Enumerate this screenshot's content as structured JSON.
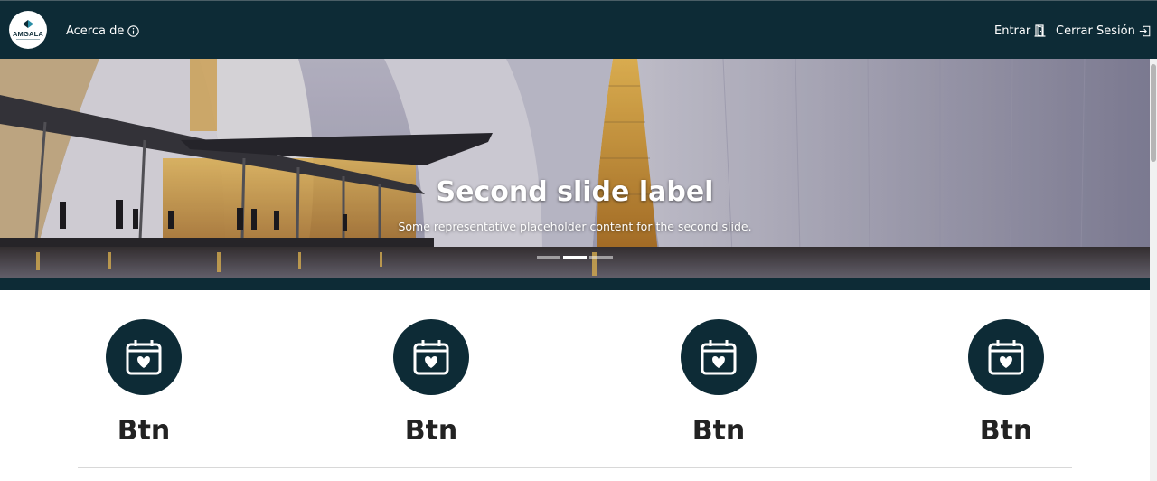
{
  "navbar": {
    "brand": "AMGALA",
    "about_label": "Acerca de",
    "login_label": "Entrar",
    "logout_label": "Cerrar Sesión"
  },
  "carousel": {
    "title": "Second slide label",
    "text": "Some representative placeholder content for the second slide.",
    "slide_count": 3,
    "active_slide": 2
  },
  "buttons": [
    {
      "label": "Btn",
      "icon": "calendar-heart-icon"
    },
    {
      "label": "Btn",
      "icon": "calendar-heart-icon"
    },
    {
      "label": "Btn",
      "icon": "calendar-heart-icon"
    },
    {
      "label": "Btn",
      "icon": "calendar-heart-icon"
    }
  ],
  "colors": {
    "primary": "#0d2b36",
    "button_text": "#222222"
  }
}
